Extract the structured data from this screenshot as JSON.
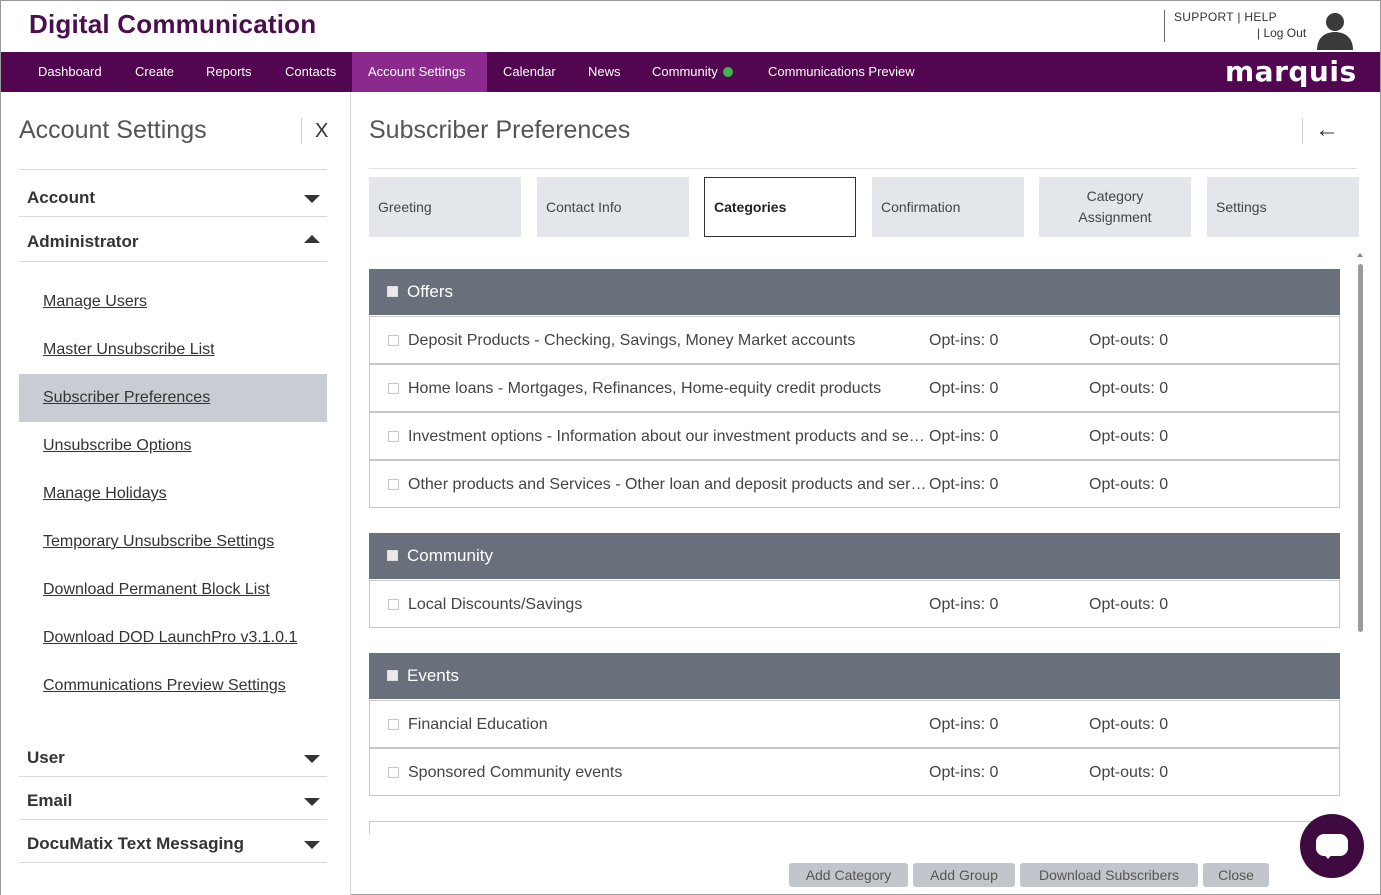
{
  "header": {
    "app_title": "Digital Communication",
    "support": "SUPPORT",
    "help": "HELP",
    "logout": "Log Out"
  },
  "nav": {
    "items": [
      "Dashboard",
      "Create",
      "Reports",
      "Contacts",
      "Account Settings",
      "Calendar",
      "News",
      "Community",
      "Communications Preview"
    ],
    "active": "Account Settings",
    "brand": "marquis",
    "community_status_color": "#3db54a"
  },
  "sidebar": {
    "title": "Account Settings",
    "close_label": "X",
    "sections": [
      {
        "label": "Account",
        "state": "collapsed"
      },
      {
        "label": "Administrator",
        "state": "expanded"
      }
    ],
    "admin_links": [
      "Manage Users",
      "Master Unsubscribe List",
      "Subscriber Preferences",
      "Unsubscribe Options",
      "Manage Holidays",
      "Temporary Unsubscribe Settings",
      "Download Permanent Block List",
      "Download DOD LaunchPro v3.1.0.1",
      "Communications Preview Settings"
    ],
    "active_link": "Subscriber Preferences",
    "bottom_sections": [
      {
        "label": "User",
        "state": "collapsed"
      },
      {
        "label": "Email",
        "state": "collapsed"
      },
      {
        "label": "DocuMatix Text Messaging",
        "state": "collapsed"
      }
    ]
  },
  "main": {
    "title": "Subscriber Preferences",
    "tabs": [
      {
        "label": "Greeting"
      },
      {
        "label": "Contact Info"
      },
      {
        "label": "Categories",
        "active": true
      },
      {
        "label": "Confirmation"
      },
      {
        "label": "Category Assignment"
      },
      {
        "label": "Settings"
      }
    ],
    "groups": [
      {
        "name": "Offers",
        "rows": [
          {
            "name": "Deposit Products - Checking, Savings, Money Market accounts",
            "optins": "Opt-ins: 0",
            "optouts": "Opt-outs: 0"
          },
          {
            "name": "Home loans - Mortgages, Refinances, Home-equity credit products",
            "optins": "Opt-ins: 0",
            "optouts": "Opt-outs: 0"
          },
          {
            "name": "Investment options - Information about our investment products and services",
            "optins": "Opt-ins: 0",
            "optouts": "Opt-outs: 0"
          },
          {
            "name": "Other products and Services - Other loan and deposit products and services",
            "optins": "Opt-ins: 0",
            "optouts": "Opt-outs: 0"
          }
        ]
      },
      {
        "name": "Community",
        "rows": [
          {
            "name": "Local Discounts/Savings",
            "optins": "Opt-ins: 0",
            "optouts": "Opt-outs: 0"
          }
        ]
      },
      {
        "name": "Events",
        "rows": [
          {
            "name": "Financial Education",
            "optins": "Opt-ins: 0",
            "optouts": "Opt-outs: 0"
          },
          {
            "name": "Sponsored Community events",
            "optins": "Opt-ins: 0",
            "optouts": "Opt-outs: 0"
          }
        ]
      }
    ],
    "buttons": {
      "add_category": "Add Category",
      "add_group": "Add Group",
      "download_subscribers": "Download Subscribers",
      "close": "Close"
    }
  },
  "colors": {
    "nav_bg": "#52064f",
    "nav_active": "#8a2a8c",
    "title_purple": "#4a0e4e",
    "group_header": "#696f7b",
    "chat_button": "#3f0a3f"
  }
}
